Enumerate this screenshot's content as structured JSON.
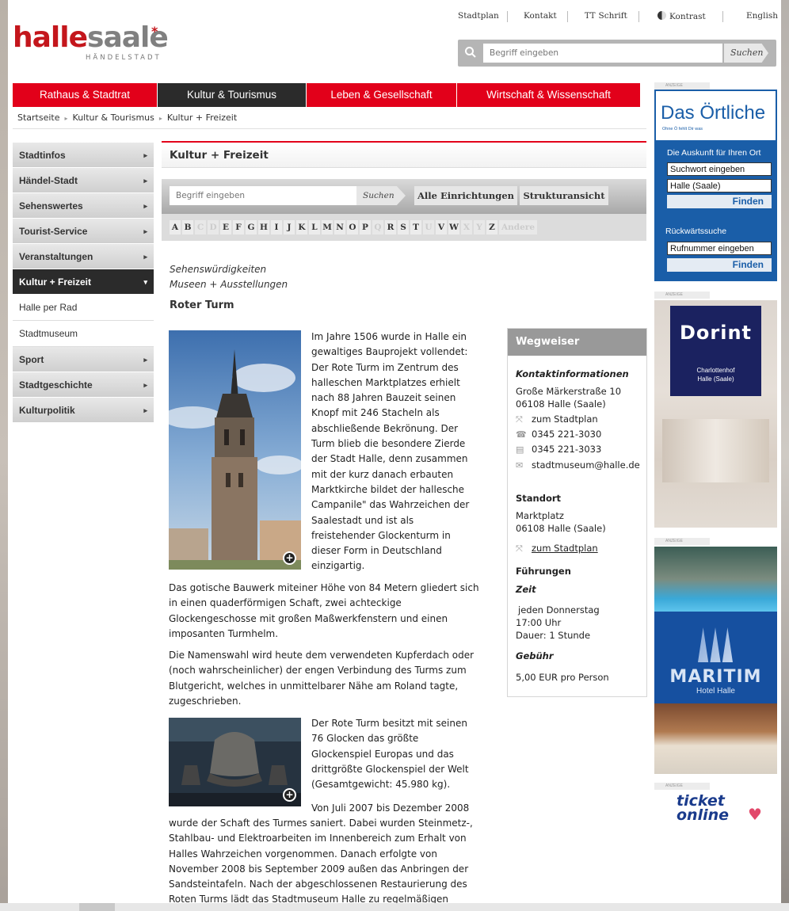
{
  "toplinks": {
    "stadtplan": "Stadtplan",
    "kontakt": "Kontakt",
    "schrift_icon": "TT",
    "schrift": "Schrift",
    "kontrast": "Kontrast",
    "english": "English"
  },
  "logo": {
    "halle": "halle",
    "saale": "saale",
    "star": "*",
    "sub": "HÄNDELSTADT"
  },
  "search_top": {
    "placeholder": "Begriff eingeben",
    "button": "Suchen"
  },
  "mainnav": [
    "Rathaus & Stadtrat",
    "Kultur & Tourismus",
    "Leben & Gesellschaft",
    "Wirtschaft & Wissenschaft"
  ],
  "breadcrumb": [
    "Startseite",
    "Kultur & Tourismus",
    "Kultur + Freizeit"
  ],
  "leftnav": {
    "items": [
      "Stadtinfos",
      "Händel-Stadt",
      "Sehenswertes",
      "Tourist-Service",
      "Veranstaltungen"
    ],
    "active": "Kultur + Freizeit",
    "subitems": [
      "Halle per Rad",
      "Stadtmuseum"
    ],
    "items2": [
      "Sport",
      "Stadtgeschichte",
      "Kulturpolitik"
    ]
  },
  "content": {
    "title": "Kultur + Freizeit",
    "filter_placeholder": "Begriff eingeben",
    "filter_button": "Suchen",
    "btn_alle": "Alle Einrichtungen",
    "btn_struktur": "Strukturansicht",
    "alphabet": [
      {
        "l": "A",
        "on": true
      },
      {
        "l": "B",
        "on": true
      },
      {
        "l": "C",
        "on": false
      },
      {
        "l": "D",
        "on": false
      },
      {
        "l": "E",
        "on": true
      },
      {
        "l": "F",
        "on": true
      },
      {
        "l": "G",
        "on": true
      },
      {
        "l": "H",
        "on": true
      },
      {
        "l": "I",
        "on": true
      },
      {
        "l": "J",
        "on": true
      },
      {
        "l": "K",
        "on": true
      },
      {
        "l": "L",
        "on": true
      },
      {
        "l": "M",
        "on": true
      },
      {
        "l": "N",
        "on": true
      },
      {
        "l": "O",
        "on": true
      },
      {
        "l": "P",
        "on": true
      },
      {
        "l": "Q",
        "on": false
      },
      {
        "l": "R",
        "on": true
      },
      {
        "l": "S",
        "on": true
      },
      {
        "l": "T",
        "on": true
      },
      {
        "l": "U",
        "on": false
      },
      {
        "l": "V",
        "on": true
      },
      {
        "l": "W",
        "on": true
      },
      {
        "l": "X",
        "on": false
      },
      {
        "l": "Y",
        "on": false
      },
      {
        "l": "Z",
        "on": true
      },
      {
        "l": "Andere",
        "on": false
      }
    ],
    "cat1": "Sehenswürdigkeiten",
    "cat2": "Museen + Ausstellungen",
    "article_title": "Roter Turm",
    "p1": "Im Jahre 1506 wurde in Halle ein gewaltiges Bauprojekt vollendet: Der Rote Turm im Zentrum des halleschen Marktplatzes erhielt nach 88 Jahren Bauzeit seinen Knopf mit 246 Stacheln als abschließende Bekrönung. Der Turm blieb die besondere Zierde der Stadt Halle, denn zusammen mit der kurz danach erbauten Marktkirche bildet der hallesche Campanile\" das Wahrzeichen der Saalestadt und ist als freistehender Glockenturm in dieser Form in Deutschland einzigartig.",
    "p2": "Das gotische Bauwerk miteiner Höhe von 84 Metern gliedert sich in einen quaderförmigen Schaft, zwei achteckige Glockengeschosse mit großen Maßwerkfenstern und einen imposanten Turmhelm.",
    "p3": "Die Namenswahl wird heute dem verwendeten Kupferdach oder (noch wahrscheinlicher) der engen Verbindung des Turms zum Blutgericht, welches in unmittelbarer Nähe am Roland tagte, zugeschrieben.",
    "p4": "Der Rote Turm besitzt mit seinen 76 Glocken das größte Glockenspiel Europas und das drittgrößte Glockenspiel der Welt (Gesamtgewicht: 45.980 kg).",
    "p5a": "Von Juli 2007 bis Dezember 2008",
    "p5b": "wurde der Schaft des Turmes saniert. Dabei wurden Steinmetz-, Stahlbau- und Elektroarbeiten im Innenbereich zum Erhalt von Halles Wahrzeichen vorgenommen. Danach erfolgte von November 2008 bis September 2009 außen das Anbringen der Sandsteintafeln. Nach der abgeschlossenen Restaurierung des Roten Turms lädt das Stadtmuseum Halle zu regelmäßigen",
    "zoom": "+"
  },
  "wegweiser": {
    "title": "Wegweiser",
    "kontakt_h": "Kontaktinformationen",
    "addr1": "Große Märkerstraße 10",
    "addr2": "06108 Halle (Saale)",
    "stadtplan": "zum Stadtplan",
    "tel": "0345 221-3030",
    "fax": "0345 221-3033",
    "mail": "stadtmuseum@halle.de",
    "standort_h": "Standort",
    "st1": "Marktplatz",
    "st2": "06108 Halle (Saale)",
    "stadtplan2": "zum Stadtplan",
    "fuehrungen_h": "Führungen",
    "zeit_h": "Zeit",
    "z1": "jeden Donnerstag",
    "z2": "17:00 Uhr",
    "z3": "Dauer: 1 Stunde",
    "gebuehr_h": "Gebühr",
    "g1": "5,00 EUR pro Person"
  },
  "ads": {
    "label": "ANZEIGE",
    "oertliche": {
      "brand": "Das Örtliche",
      "slogan": "Ohne Ö fehlt Dir was",
      "headline": "Die Auskunft für Ihren Ort",
      "field1": "Suchwort eingeben",
      "field2": "Halle (Saale)",
      "btn": "Finden",
      "rueck": "Rückwärtssuche",
      "field3": "Rufnummer eingeben",
      "btn2": "Finden"
    },
    "dorint": {
      "brand": "Dorint",
      "l1": "Charlottenhof",
      "l2": "Halle (Saale)"
    },
    "maritim": {
      "brand": "MARITIM",
      "sub": "Hotel Halle"
    },
    "ticket": {
      "l1": "ticket",
      "l2": "online",
      "heart": "♥"
    }
  },
  "icons": {
    "search": "search-icon",
    "chevron_right": "▸",
    "chevron_down": "▾",
    "bc_arrow": "▸",
    "contrast": "contrast-icon"
  }
}
